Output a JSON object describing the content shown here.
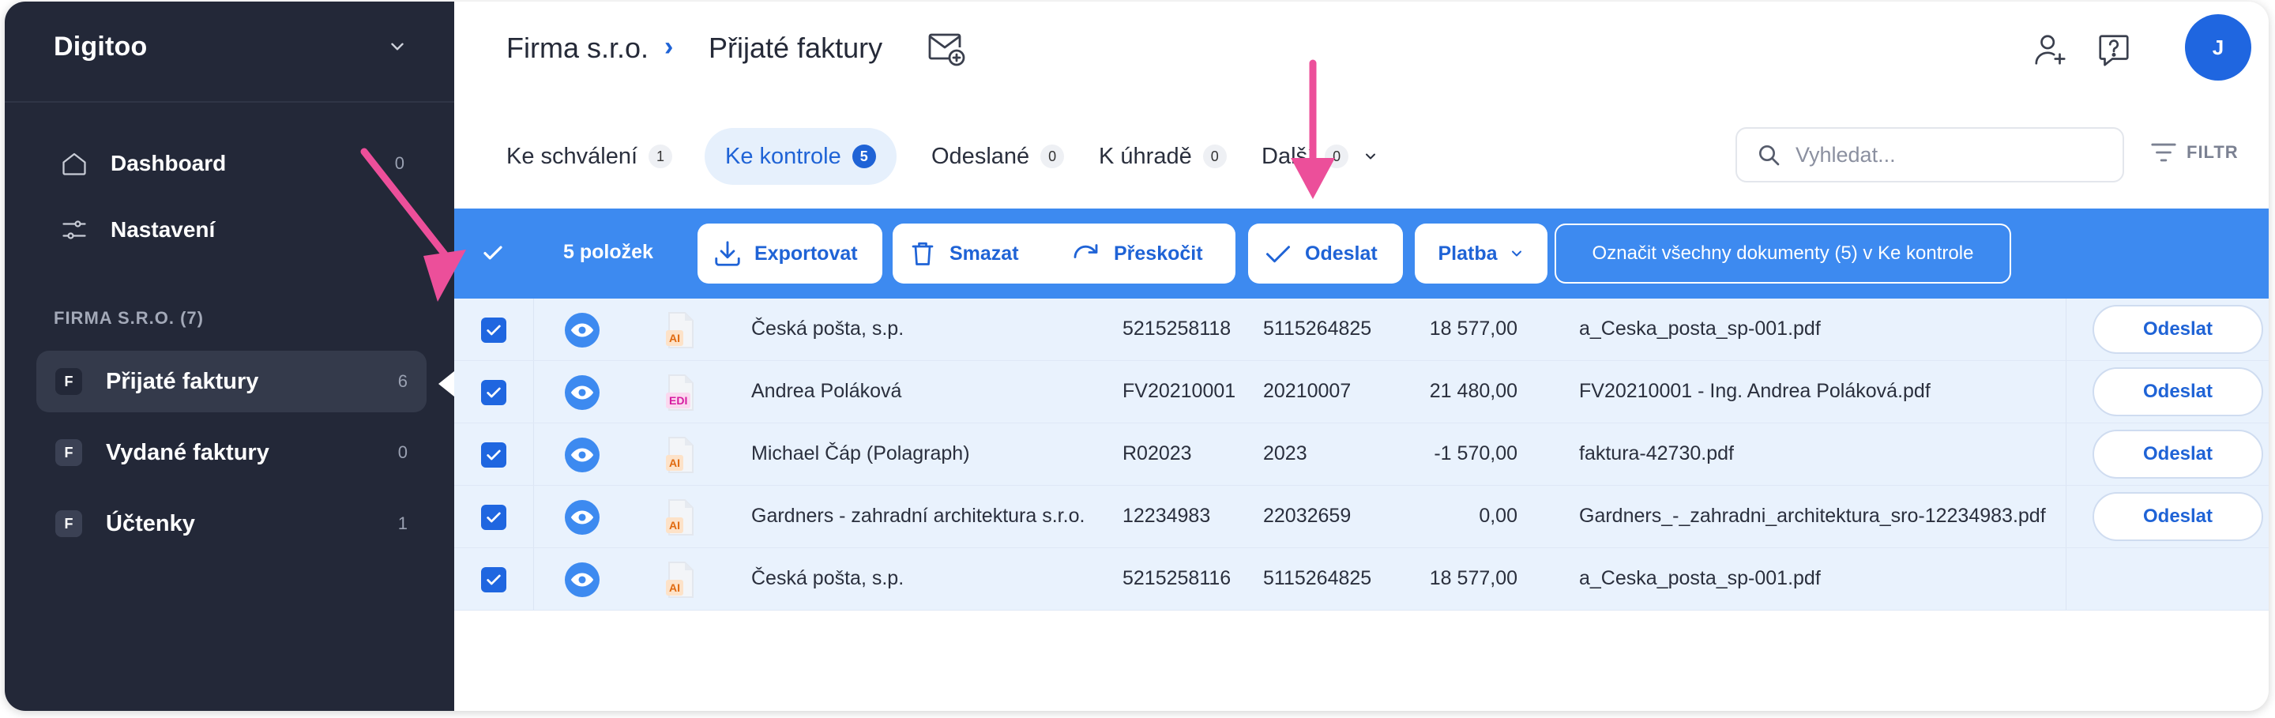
{
  "sidebar": {
    "brand": "Digitoo",
    "nav": [
      {
        "label": "Dashboard",
        "count": "0",
        "icon": "home-icon"
      },
      {
        "label": "Nastavení",
        "count": "",
        "icon": "sliders-icon"
      }
    ],
    "section_title": "FIRMA S.R.O. (7)",
    "firm_items": [
      {
        "badge": "F",
        "label": "Přijaté faktury",
        "count": "6",
        "active": true
      },
      {
        "badge": "F",
        "label": "Vydané faktury",
        "count": "0",
        "active": false
      },
      {
        "badge": "F",
        "label": "Účtenky",
        "count": "1",
        "active": false
      }
    ]
  },
  "header": {
    "breadcrumb_firm": "Firma s.r.o.",
    "breadcrumb_sep": "›",
    "page_title": "Přijaté faktury",
    "avatar_initial": "J"
  },
  "tabs": [
    {
      "label": "Ke schválení",
      "count": "1"
    },
    {
      "label": "Ke kontrole",
      "count": "5",
      "active": true
    },
    {
      "label": "Odeslané",
      "count": "0"
    },
    {
      "label": "K úhradě",
      "count": "0"
    },
    {
      "label": "Další",
      "count": "0"
    }
  ],
  "search": {
    "placeholder": "Vyhledat..."
  },
  "filter_label": "FILTR",
  "actionbar": {
    "selected_count": "5 položek",
    "export": "Exportovat",
    "delete": "Smazat",
    "skip": "Přeskočit",
    "send": "Odeslat",
    "payment": "Platba",
    "mark_all": "Označit všechny dokumenty (5) v Ke kontrole"
  },
  "rows": [
    {
      "tag": "AI",
      "supplier": "Česká pošta, s.p.",
      "number": "5215258118",
      "variable": "5115264825",
      "amount": "18 577,00",
      "file": "a_Ceska_posta_sp-001.pdf",
      "action": "Odeslat"
    },
    {
      "tag": "EDI",
      "supplier": "Andrea Poláková",
      "number": "FV20210001",
      "variable": "20210007",
      "amount": "21 480,00",
      "file": "FV20210001 - Ing. Andrea Poláková.pdf",
      "action": "Odeslat"
    },
    {
      "tag": "AI",
      "supplier": "Michael Čáp (Polagraph)",
      "number": "R02023",
      "variable": "2023",
      "amount": "-1 570,00",
      "file": "faktura-42730.pdf",
      "action": "Odeslat"
    },
    {
      "tag": "AI",
      "supplier": "Gardners - zahradní architektura s.r.o.",
      "number": "12234983",
      "variable": "22032659",
      "amount": "0,00",
      "file": "Gardners_-_zahradni_architektura_sro-12234983.pdf",
      "action": "Odeslat"
    },
    {
      "tag": "AI",
      "supplier": "Česká pošta, s.p.",
      "number": "5215258116",
      "variable": "5115264825",
      "amount": "18 577,00",
      "file": "a_Ceska_posta_sp-001.pdf",
      "action": ""
    }
  ],
  "colors": {
    "sidebar_bg": "#232838",
    "accent": "#1f66e0",
    "actionbar_bg": "#3d8af0",
    "row_bg": "#e9f2fd",
    "annotation_arrow": "#ec4f9a"
  }
}
